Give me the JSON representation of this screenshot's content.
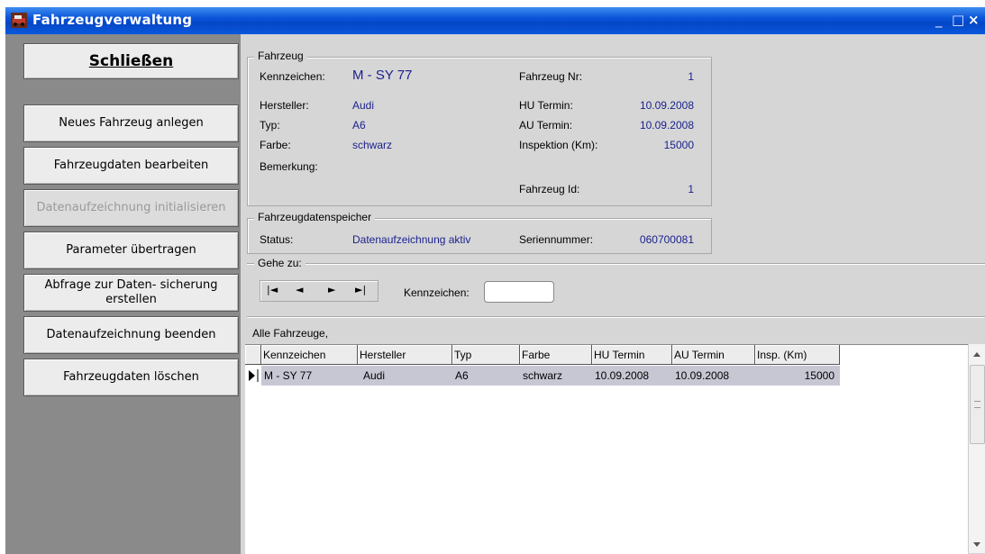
{
  "window": {
    "title": "Fahrzeugverwaltung",
    "minimize": "_",
    "maximize": "□",
    "close": "×"
  },
  "buttons": {
    "close": "Schließen",
    "new_vehicle": "Neues Fahrzeug anlegen",
    "edit_vehicle": "Fahrzeugdaten bearbeiten",
    "init_recording": "Datenaufzeichnung initialisieren",
    "transfer_params": "Parameter übertragen",
    "backup_query_line1": "Abfrage zur Daten- sicherung",
    "backup_query_line2": "erstellen",
    "end_recording": "Datenaufzeichnung beenden",
    "delete_vehicle": "Fahrzeugdaten löschen"
  },
  "vehicle": {
    "legend": "Fahrzeug",
    "plate_label": "Kennzeichen:",
    "plate": "M - SY 77",
    "manufacturer_label": "Hersteller:",
    "manufacturer": "Audi",
    "type_label": "Typ:",
    "type": "A6",
    "color_label": "Farbe:",
    "color": "schwarz",
    "remark_label": "Bemerkung:",
    "number_label": "Fahrzeug Nr:",
    "number": "1",
    "hu_label": "HU Termin:",
    "hu": "10.09.2008",
    "au_label": "AU Termin:",
    "au": "10.09.2008",
    "inspection_label": "Inspektion (Km):",
    "inspection": "15000",
    "id_label": "Fahrzeug Id:",
    "id": "1"
  },
  "recorder": {
    "legend": "Fahrzeugdatenspeicher",
    "status_label": "Status:",
    "status": "Datenaufzeichnung aktiv",
    "serial_label": "Seriennummer:",
    "serial": "060700081"
  },
  "goto": {
    "legend": "Gehe zu:",
    "first": "|◄",
    "prev": "◄",
    "next": "►",
    "last": "►|",
    "plate_label": "Kennzeichen:",
    "plate_value": ""
  },
  "list": {
    "title": "Alle Fahrzeuge,",
    "columns": [
      "Kennzeichen",
      "Hersteller",
      "Typ",
      "Farbe",
      "HU Termin",
      "AU Termin",
      "Insp. (Km)"
    ],
    "rows": [
      [
        "M - SY 77",
        "Audi",
        "A6",
        "schwarz",
        "10.09.2008",
        "10.09.2008",
        "15000"
      ]
    ]
  },
  "colors": {
    "titlebar": "#0a54d8",
    "value_text": "#1a1f8c",
    "selected_row": "#c7c7d4"
  }
}
